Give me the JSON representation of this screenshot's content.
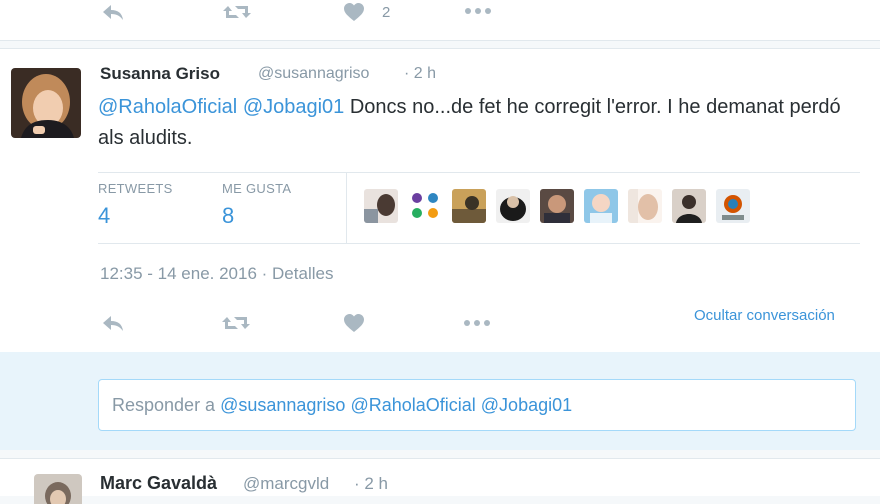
{
  "prev_tweet": {
    "like_count": "2"
  },
  "tweet": {
    "fullname": "Susanna Griso",
    "username": "@susannagriso",
    "time": "· 2 h",
    "mention1": "@RaholaOficial",
    "mention2": "@Jobagi01",
    "text": " Doncs no...de fet he corregit l'error. I he demanat perdó als aludits.",
    "retweets_label": "RETWEETS",
    "retweets_count": "4",
    "likes_label": "ME GUSTA",
    "likes_count": "8",
    "timestamp": "12:35 - 14 ene. 2016",
    "details_sep": " · ",
    "details_label": "Detalles",
    "hide_conversation": "Ocultar conversación"
  },
  "reply": {
    "prefix": "Responder a ",
    "mention1": "@susannagriso",
    "mention2": "@RaholaOficial",
    "mention3": "@Jobagi01"
  },
  "next_tweet": {
    "fullname": "Marc Gavaldà",
    "username": "@marcgvld",
    "time": "· 2 h"
  },
  "icons": [
    "reply-icon",
    "retweet-icon",
    "like-icon",
    "more-icon"
  ],
  "colors": {
    "link": "#3b94d9",
    "muted": "#8899a6",
    "icon": "#aab8c2"
  }
}
